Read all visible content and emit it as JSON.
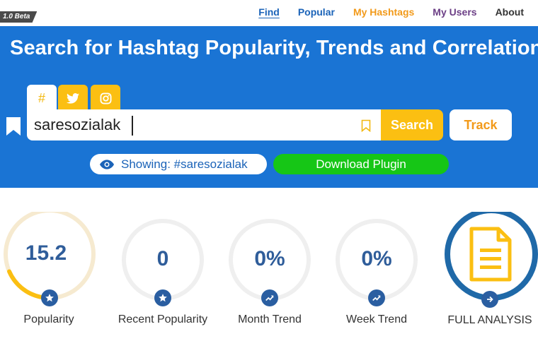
{
  "header": {
    "beta_label": "1.0 Beta",
    "nav": [
      {
        "label": "Find"
      },
      {
        "label": "Popular"
      },
      {
        "label": "My Hashtags"
      },
      {
        "label": "My Users"
      },
      {
        "label": "About"
      }
    ]
  },
  "hero": {
    "title": "Search for Hashtag Popularity, Trends and Correlations",
    "tabs": [
      {
        "icon": "hash-icon",
        "glyph": "#",
        "active": true
      },
      {
        "icon": "twitter-icon",
        "active": false
      },
      {
        "icon": "instagram-icon",
        "active": false
      }
    ],
    "search": {
      "value": "saresozialak",
      "button_label": "Search"
    },
    "track_label": "Track",
    "showing_text": "Showing: #saresozialak",
    "download_label": "Download Plugin"
  },
  "stats": [
    {
      "value": "15.2",
      "label": "Popularity",
      "icon": "star-icon",
      "fill": 0.152
    },
    {
      "value": "0",
      "label": "Recent Popularity",
      "icon": "star-icon",
      "fill": 0
    },
    {
      "value": "0%",
      "label": "Month Trend",
      "icon": "trend-icon",
      "fill": 0
    },
    {
      "value": "0%",
      "label": "Week Trend",
      "icon": "trend-icon",
      "fill": 0
    },
    {
      "value": "",
      "label": "FULL ANALYSIS",
      "icon": "arrow-right-icon"
    }
  ],
  "colors": {
    "hero_blue": "#1a74d4",
    "accent_yellow": "#fbbf12",
    "download_green": "#16c616",
    "value_blue": "#2f5d9a",
    "ring_gray": "#efefef",
    "popularity_track": "#f6ead0"
  }
}
